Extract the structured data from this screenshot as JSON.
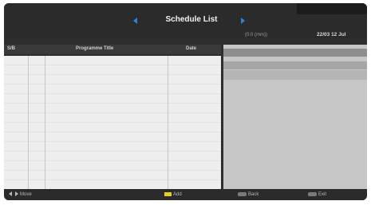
{
  "header": {
    "title": "Schedule List",
    "time": "(0:0 (mm))",
    "date": "22/03 12 Jul"
  },
  "table": {
    "columns": [
      "S/B",
      "Programme Title",
      "Date"
    ],
    "rows": []
  },
  "footer": {
    "move_label": "Move",
    "add_label": "Add",
    "back_label": "Back",
    "exit_label": "Exit"
  },
  "colors": {
    "accent_arrow": "#2f86d6",
    "add_key": "#e3d21a"
  }
}
